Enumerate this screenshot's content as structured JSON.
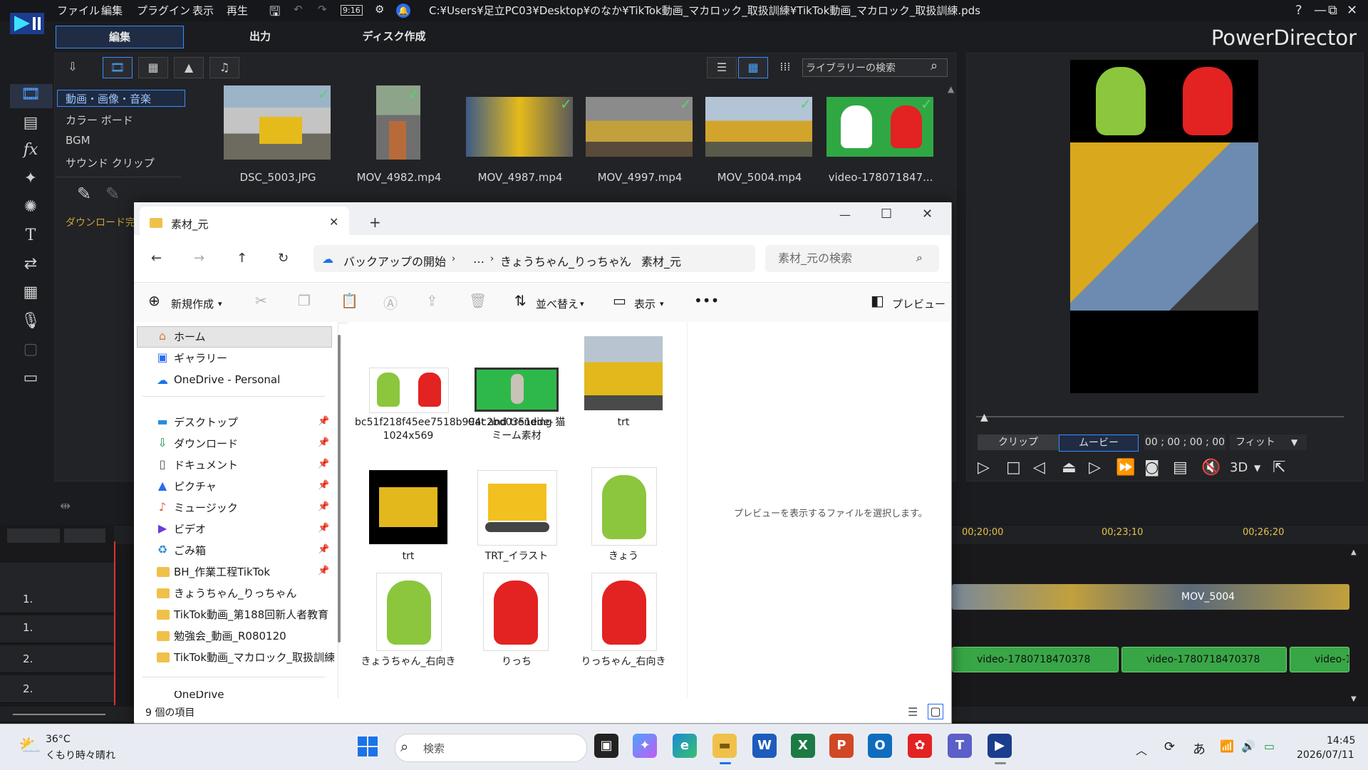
{
  "pd": {
    "menu": [
      "ファイル",
      "編集",
      "プラグイン",
      "表示",
      "再生"
    ],
    "timecode_badge": "9:16",
    "path": "C:¥Users¥足立PC03¥Desktop¥のなか¥TikTok動画_マカロック_取扱訓練¥TikTok動画_マカロック_取扱訓練.pds",
    "tabs": [
      "編集",
      "出力",
      "ディスク作成"
    ],
    "brand": "PowerDirector",
    "win_controls": [
      "?",
      "—",
      "⧉",
      "✕"
    ]
  },
  "library": {
    "categories": [
      "動画・画像・音楽",
      "カラー ボード",
      "BGM",
      "サウンド クリップ"
    ],
    "download_label": "ダウンロード完了",
    "search_placeholder": "ライブラリーの検索",
    "items": [
      "DSC_5003.JPG",
      "MOV_4982.mp4",
      "MOV_4987.mp4",
      "MOV_4997.mp4",
      "MOV_5004.mp4",
      "video-178071847..."
    ]
  },
  "preview": {
    "clip_btn": "クリップ",
    "movie_btn": "ムービー",
    "timecode": "00 ; 00 ; 00 ; 00",
    "fit": "フィット",
    "mode3d": "3D"
  },
  "timeline": {
    "times": [
      "00;20;00",
      "00;23;10",
      "00;26;20"
    ],
    "track_labels": [
      "1.",
      "1.",
      "2.",
      "2."
    ],
    "clips": [
      "MOV_5004",
      "video-1780718470378",
      "video-1780718470378",
      "video-1"
    ]
  },
  "explorer": {
    "tab_title": "素材_元",
    "breadcrumbs": [
      "バックアップの開始",
      "…",
      "きょうちゃん_りっちゃん",
      "素材_元"
    ],
    "search_placeholder": "素材_元の検索",
    "commands": {
      "new": "新規作成",
      "sort": "並べ替え",
      "view": "表示",
      "preview": "プレビュー"
    },
    "nav": {
      "home": "ホーム",
      "gallery": "ギャラリー",
      "onedrive": "OneDrive - Personal",
      "pinned": [
        "デスクトップ",
        "ダウンロード",
        "ドキュメント",
        "ピクチャ",
        "ミュージック",
        "ビデオ",
        "ごみ箱",
        "BH_作業工程TikTok"
      ],
      "folders": [
        "きょうちゃん_りっちゃん",
        "TikTok動画_第188回新人者教育",
        "勉強会_動画_R080120",
        "TikTok動画_マカロック_取扱訓練"
      ],
      "bottom": "OneDrive"
    },
    "files": [
      "bc51f218f45ee7518b994c2bd0351ede-1024x569",
      "Cat and trending 猫ミーム素材",
      "trt",
      "trt",
      "TRT_イラスト",
      "きょう",
      "きょうちゃん_右向き",
      "りっち",
      "りっちゃん_右向き"
    ],
    "preview_message": "プレビューを表示するファイルを選択します。",
    "status": "9 個の項目"
  },
  "taskbar": {
    "weather_temp": "36°C",
    "weather_desc": "くもり時々晴れ",
    "search": "検索",
    "ime": "あ",
    "time": "14:45",
    "date": "2026/07/11"
  }
}
